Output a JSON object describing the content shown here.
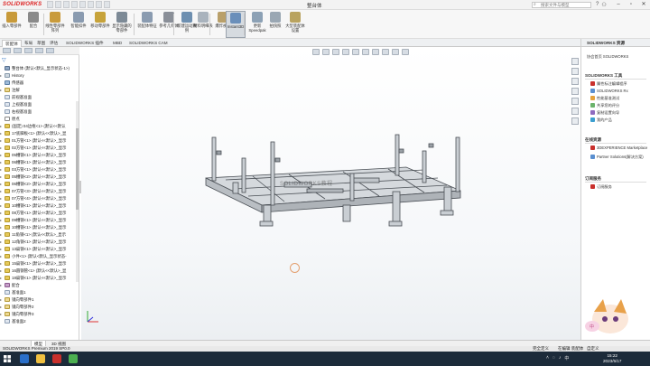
{
  "app": {
    "brand": "SOLIDWORKS",
    "doc_title": "整台体",
    "search_placeholder": "搜索文件与模型"
  },
  "ribbon": [
    {
      "label": "插入零部件",
      "color": "#c89a3a"
    },
    {
      "label": "配合",
      "color": "#8a8a8a"
    },
    {
      "label": "线性零部件阵列",
      "color": "#c99b3c"
    },
    {
      "label": "智能扣件",
      "color": "#8a9bb0"
    },
    {
      "label": "移动零部件",
      "color": "#c7a33a"
    },
    {
      "label": "显示隐藏的零部件",
      "color": "#7d8a96"
    },
    {
      "label": "装配体特征",
      "color": "#8a9bb0"
    },
    {
      "label": "参考几何体",
      "color": "#8a8f98"
    },
    {
      "label": "新建运动算例",
      "color": "#6d8fb0"
    },
    {
      "label": "材料明细表",
      "color": "#a9b3bd"
    },
    {
      "label": "爆炸视图",
      "color": "#b9a06a"
    },
    {
      "label": "Instant3D",
      "color": "#6a8fba"
    },
    {
      "label": "更新 Speedpak",
      "color": "#8ca1b5"
    },
    {
      "label": "拍快照",
      "color": "#9aa7b3"
    },
    {
      "label": "大型装配体设置",
      "color": "#b9a35f"
    }
  ],
  "command_tabs": [
    "装配体",
    "布局",
    "草图",
    "评估",
    "SOLIDWORKS 插件",
    "MBD",
    "SOLIDWORKS CAM"
  ],
  "tree": {
    "items": [
      {
        "text": "整台体 (默认<默认_显示状态-1>)",
        "icon": "root",
        "exp": ""
      },
      {
        "text": "History",
        "icon": "history",
        "exp": "▸"
      },
      {
        "text": "传感器",
        "icon": "sensor",
        "exp": ""
      },
      {
        "text": "注解",
        "icon": "folder",
        "exp": "▸"
      },
      {
        "text": "前视基准面",
        "icon": "plane",
        "exp": ""
      },
      {
        "text": "上视基准面",
        "icon": "plane",
        "exp": ""
      },
      {
        "text": "右视基准面",
        "icon": "plane",
        "exp": ""
      },
      {
        "text": "原点",
        "icon": "origin",
        "exp": ""
      },
      {
        "text": "(固定) 04边框<1> (默认<<默认",
        "icon": "part",
        "exp": "▸"
      },
      {
        "text": "17底脚板<1> (默认<<默认>_显",
        "icon": "part",
        "exp": "▸"
      },
      {
        "text": "01方管<1> (默认<<默认>_显示",
        "icon": "part",
        "exp": "▸"
      },
      {
        "text": "02方管<1> (默认<<默认>_显示",
        "icon": "part",
        "exp": "▸"
      },
      {
        "text": "05槽钢<1> (默认<<默认>_显示",
        "icon": "part",
        "exp": "▸"
      },
      {
        "text": "06槽钢<1> (默认<<默认>_显示",
        "icon": "part",
        "exp": "▸"
      },
      {
        "text": "03方管<1> (默认<<默认>_显示",
        "icon": "part",
        "exp": "▸"
      },
      {
        "text": "05槽钢<2> (默认<<默认>_显示",
        "icon": "part",
        "exp": "▸"
      },
      {
        "text": "06槽钢<2> (默认<<默认>_显示",
        "icon": "part",
        "exp": "▸"
      },
      {
        "text": "07方管<3> (默认<<默认>_显示",
        "icon": "part",
        "exp": "▸"
      },
      {
        "text": "07方管<4> (默认<<默认>_显示",
        "icon": "part",
        "exp": "▸"
      },
      {
        "text": "10槽钢<1> (默认<<默认>_显示",
        "icon": "part",
        "exp": "▸"
      },
      {
        "text": "08方管<1> (默认<<默认>_显示",
        "icon": "part",
        "exp": "▸"
      },
      {
        "text": "09槽钢<1> (默认<<默认>_显示",
        "icon": "part",
        "exp": "▸"
      },
      {
        "text": "10槽钢<1> (默认<<默认>_显示",
        "icon": "part",
        "exp": "▸"
      },
      {
        "text": "11角钢<1> (默认<<默认>_显示",
        "icon": "part",
        "exp": "▸"
      },
      {
        "text": "12角钢<1> (默认<<默认>_显示",
        "icon": "part",
        "exp": "▸"
      },
      {
        "text": "13扁钢<1> (默认<<默认>_显示",
        "icon": "part",
        "exp": "▸"
      },
      {
        "text": "小件<1> (默认<默认_显示状态-",
        "icon": "part",
        "exp": "▸"
      },
      {
        "text": "15扁钢<1> (默认<<默认>_显示",
        "icon": "part",
        "exp": "▸"
      },
      {
        "text": "16圆钢管<1> (默认<<默认>_显",
        "icon": "part",
        "exp": "▸"
      },
      {
        "text": "18扁钢<1> (默认<<默认>_显示",
        "icon": "part",
        "exp": "▸"
      },
      {
        "text": "配合",
        "icon": "mate",
        "exp": "▸"
      },
      {
        "text": "基准面1",
        "icon": "plane",
        "exp": ""
      },
      {
        "text": "镜向零部件1",
        "icon": "folder",
        "exp": "▸"
      },
      {
        "text": "镜向零部件2",
        "icon": "folder",
        "exp": "▸"
      },
      {
        "text": "镜向零部件3",
        "icon": "folder",
        "exp": "▸"
      },
      {
        "text": "基准面2",
        "icon": "plane",
        "exp": ""
      }
    ]
  },
  "viewport": {
    "watermark": "SOLIDWORKS教程"
  },
  "resources": {
    "title": "SOLIDWORKS 资源",
    "sections": [
      {
        "title": "SOLIDWORKS 工具",
        "links": [
          "属性标注编辑程序",
          "SOLIDWORKS Rx",
          "性能基准测试",
          "共享您的评分",
          "复制设置向导",
          "我的产品"
        ]
      },
      {
        "title": "在线资源",
        "links": [
          "3DEXPERIENCE Marketplace",
          "Partner Solutions(解决方案)"
        ]
      },
      {
        "title": "订阅服务",
        "links": [
          "订阅服务"
        ]
      }
    ],
    "top_links": [
      "协会首页 SOLIDWORKS"
    ]
  },
  "model_tabs": [
    "模型",
    "3D 视图"
  ],
  "status": {
    "left": "SOLIDWORKS Premium 2019 SP0.0",
    "r1": "完全定义",
    "r2": "在编辑 装配体",
    "r3": "自定义"
  },
  "taskbar": {
    "time": "15:22",
    "date": "2023/5/17"
  }
}
